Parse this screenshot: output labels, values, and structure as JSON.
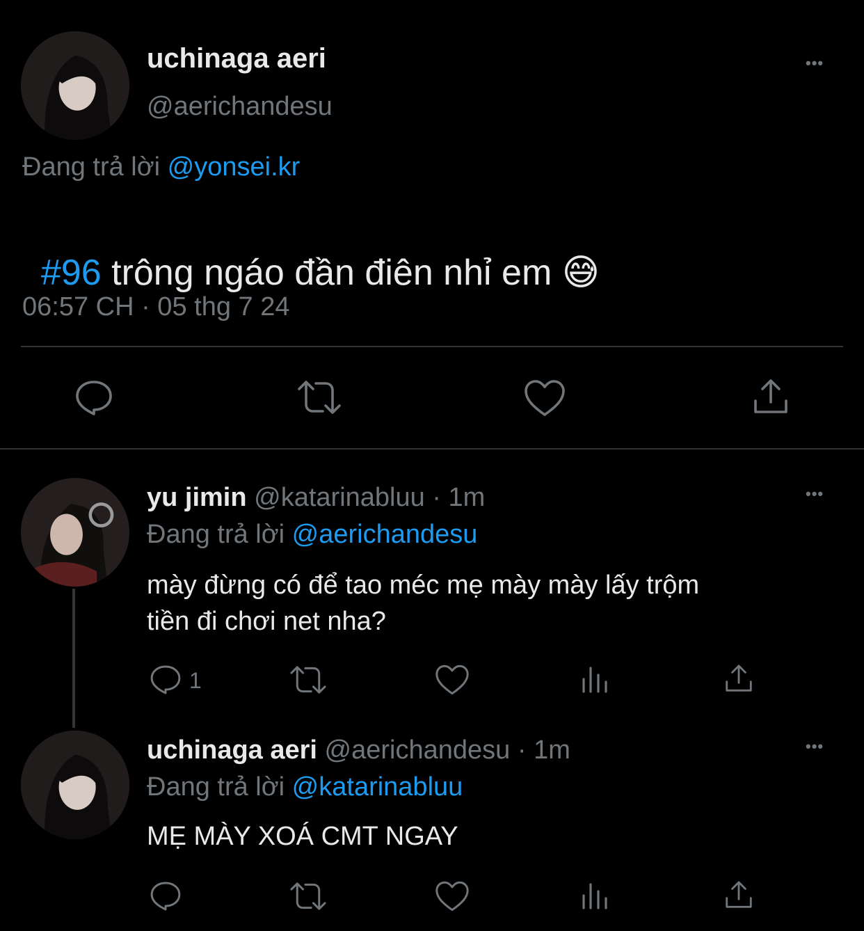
{
  "main_tweet": {
    "display_name": "uchinaga aeri",
    "handle": "@aerichandesu",
    "replying_prefix": "Đang trả lời",
    "replying_to": "@yonsei.kr",
    "hashtag": "#96",
    "text": " trông ngáo đần điên nhỉ em ",
    "emoji": "😅",
    "timestamp": "06:57 CH · 05 thg 7 24"
  },
  "replies": [
    {
      "display_name": "yu jimin",
      "handle": "@katarinabluu",
      "age": " · 1m",
      "replying_prefix": "Đang trả lời",
      "replying_to": "@aerichandesu",
      "text_line1": "mày đừng có để tao méc mẹ mày mày lấy trộm",
      "text_line2": "tiền đi chơi net nha?",
      "reply_count": "1"
    },
    {
      "display_name": "uchinaga aeri",
      "handle": "@aerichandesu",
      "age": " · 1m",
      "replying_prefix": "Đang trả lời",
      "replying_to": "@katarinabluu",
      "text_line1": "MẸ MÀY XOÁ CMT NGAY"
    }
  ],
  "more_glyph": "•••",
  "colors": {
    "background": "#000000",
    "text": "#e7e9ea",
    "muted": "#71767b",
    "link": "#1d9bf0",
    "divider": "#2f3336"
  },
  "icons": [
    "reply-icon",
    "retweet-icon",
    "like-icon",
    "views-icon",
    "share-icon",
    "more-icon"
  ]
}
